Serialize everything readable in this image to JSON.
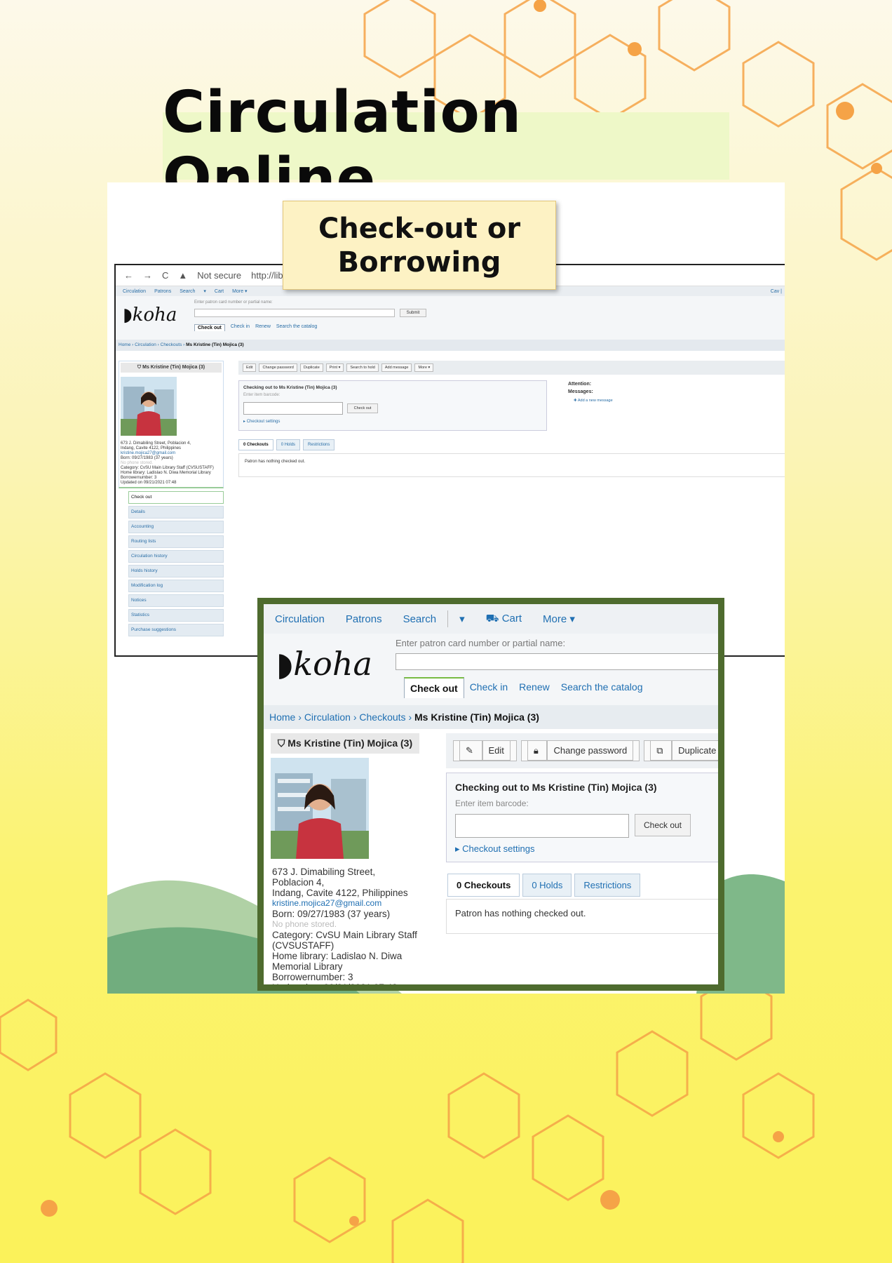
{
  "slide": {
    "title": "Circulation Online",
    "callout_line1": "Check-out or",
    "callout_line2": "Borrowing"
  },
  "colors": {
    "frame_green": "#4e6b2e",
    "koha_link": "#1f6fb2",
    "hexagon_orange": "#f5a347"
  },
  "browser": {
    "back_icon": "←",
    "forward_icon": "→",
    "reload_icon": "C",
    "security_label": "Not secure",
    "url": "http://library.cvsu."
  },
  "koha": {
    "menu": [
      "Circulation",
      "Patrons",
      "Search",
      "▾",
      "Cart",
      "More ▾"
    ],
    "menu_right": "Cav |",
    "logo": "koha",
    "search_hint": "Enter patron card number or partial name:",
    "submit_label": "Submit",
    "search_tabs": [
      "Check out",
      "Check in",
      "Renew",
      "Search the catalog"
    ],
    "breadcrumb": {
      "home": "Home",
      "circulation": "Circulation",
      "checkouts": "Checkouts",
      "current": "Ms Kristine (Tin) Mojica (3)"
    },
    "patron": {
      "name": "Ms Kristine (Tin) Mojica (3)",
      "address1": "673 J. Dimabiling Street, Poblacion 4,",
      "address2": "Indang, Cavite 4122, Philippines",
      "email": "kristine.mojica27@gmail.com",
      "born": "Born: 09/27/1983 (37 years)",
      "phone": "No phone stored.",
      "category": "Category: CvSU Main Library Staff (CVSUSTAFF)",
      "home_library": "Home library: Ladislao N. Diwa Memorial Library",
      "borrowernumber": "Borrowernumber: 3",
      "updated": "Updated on 09/21/2021 07:48"
    },
    "sidebar_nav": [
      "Check out",
      "Details",
      "Accounting",
      "Routing lists",
      "Circulation history",
      "Holds history",
      "Modification log",
      "Notices",
      "Statistics",
      "Purchase suggestions"
    ],
    "toolbar": [
      "Edit",
      "Change password",
      "Duplicate",
      "Print ▾",
      "Search to hold",
      "Add message",
      "More ▾"
    ],
    "checkout": {
      "heading": "Checking out to Ms Kristine (Tin) Mojica (3)",
      "barcode_hint": "Enter item barcode:",
      "button": "Check out",
      "settings": "Checkout settings"
    },
    "attention": "Attention:",
    "messages": "Messages:",
    "add_message": "Add a new message",
    "tabs": [
      "0 Checkouts",
      "0 Holds",
      "Restrictions"
    ],
    "tab_body": "Patron has nothing checked out."
  }
}
